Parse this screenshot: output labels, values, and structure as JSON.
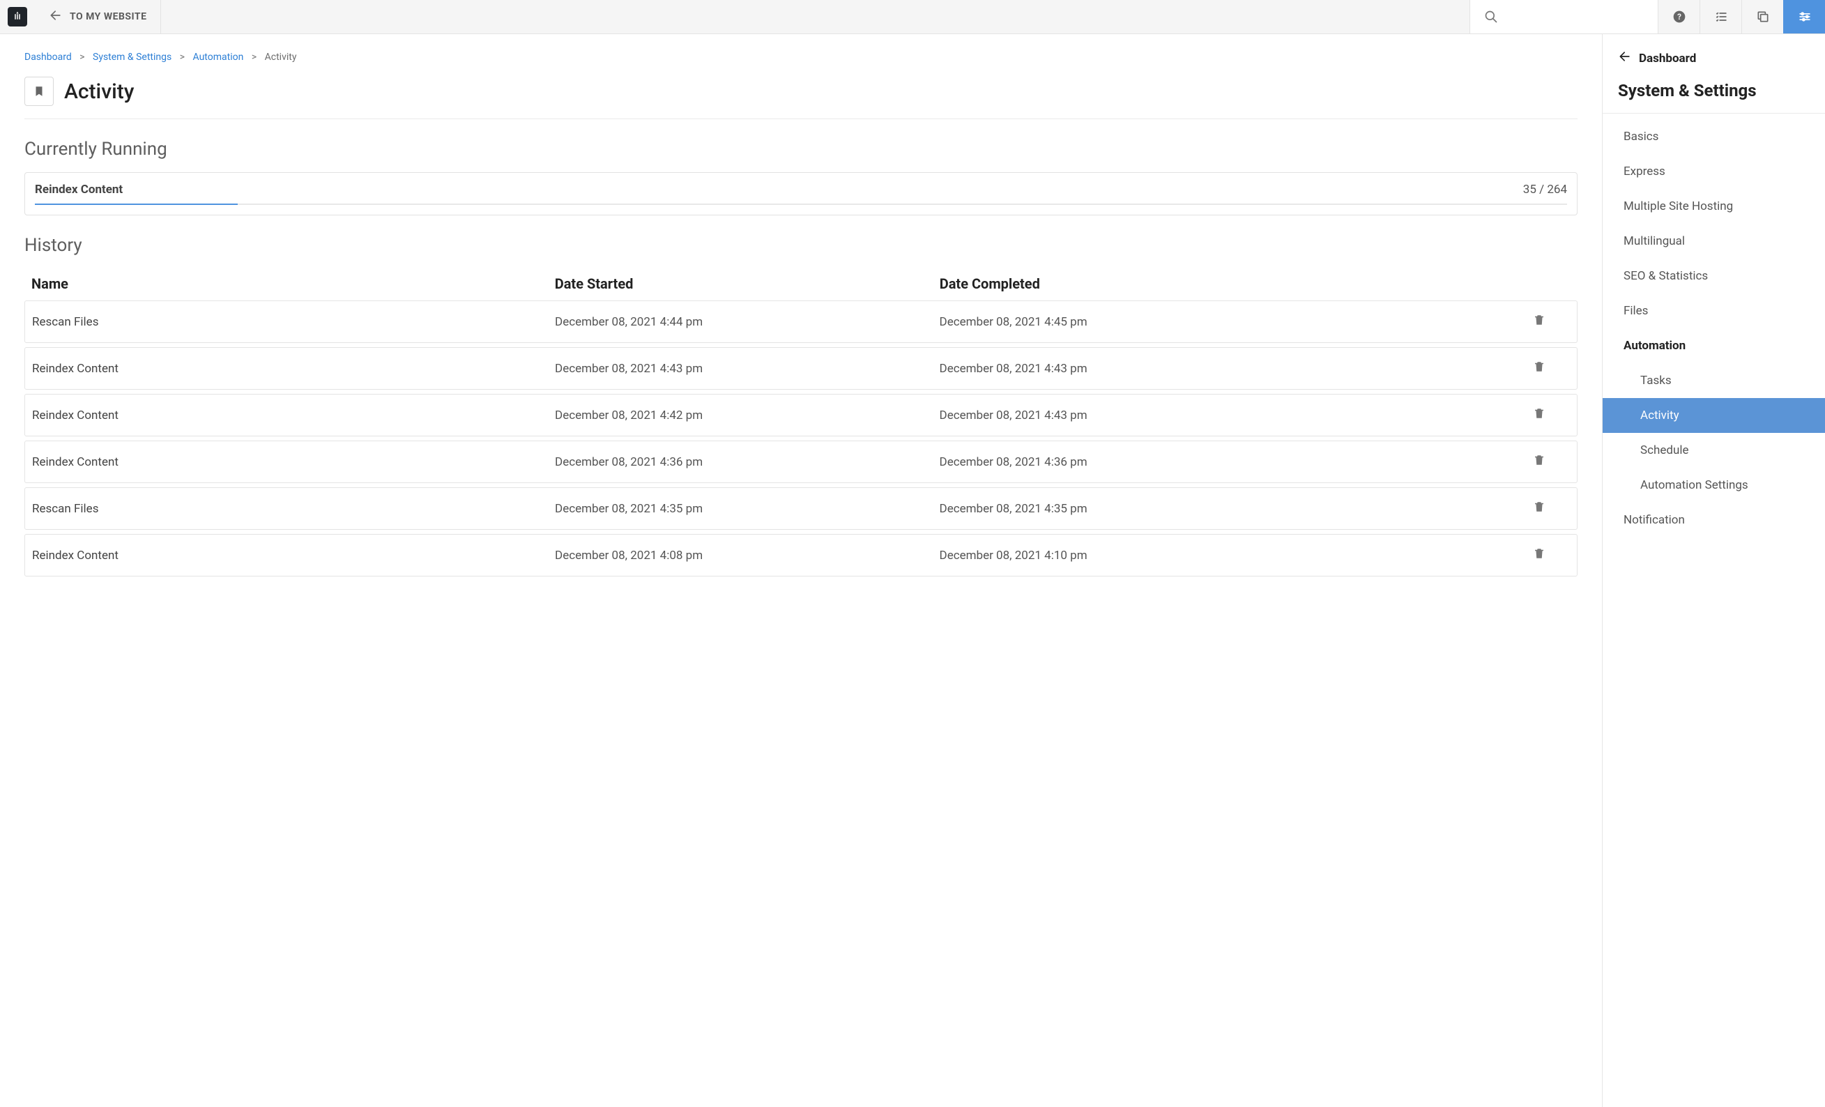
{
  "topbar": {
    "back_label": "TO MY WEBSITE"
  },
  "breadcrumb": {
    "items": [
      "Dashboard",
      "System & Settings",
      "Automation"
    ],
    "current": "Activity"
  },
  "page": {
    "title": "Activity"
  },
  "running": {
    "section_label": "Currently Running",
    "task_name": "Reindex Content",
    "progress_text": "35 / 264",
    "progress_current": 35,
    "progress_total": 264
  },
  "history": {
    "section_label": "History",
    "columns": {
      "name": "Name",
      "started": "Date Started",
      "completed": "Date Completed"
    },
    "rows": [
      {
        "name": "Rescan Files",
        "started": "December 08, 2021 4:44 pm",
        "completed": "December 08, 2021 4:45 pm"
      },
      {
        "name": "Reindex Content",
        "started": "December 08, 2021 4:43 pm",
        "completed": "December 08, 2021 4:43 pm"
      },
      {
        "name": "Reindex Content",
        "started": "December 08, 2021 4:42 pm",
        "completed": "December 08, 2021 4:43 pm"
      },
      {
        "name": "Reindex Content",
        "started": "December 08, 2021 4:36 pm",
        "completed": "December 08, 2021 4:36 pm"
      },
      {
        "name": "Rescan Files",
        "started": "December 08, 2021 4:35 pm",
        "completed": "December 08, 2021 4:35 pm"
      },
      {
        "name": "Reindex Content",
        "started": "December 08, 2021 4:08 pm",
        "completed": "December 08, 2021 4:10 pm"
      }
    ]
  },
  "sidepanel": {
    "back_label": "Dashboard",
    "title": "System & Settings",
    "items": [
      {
        "label": "Basics",
        "type": "link"
      },
      {
        "label": "Express",
        "type": "link"
      },
      {
        "label": "Multiple Site Hosting",
        "type": "link"
      },
      {
        "label": "Multilingual",
        "type": "link"
      },
      {
        "label": "SEO & Statistics",
        "type": "link"
      },
      {
        "label": "Files",
        "type": "link"
      },
      {
        "label": "Automation",
        "type": "header"
      },
      {
        "label": "Tasks",
        "type": "sub"
      },
      {
        "label": "Activity",
        "type": "sub",
        "active": true
      },
      {
        "label": "Schedule",
        "type": "sub"
      },
      {
        "label": "Automation Settings",
        "type": "sub"
      },
      {
        "label": "Notification",
        "type": "link"
      }
    ]
  }
}
